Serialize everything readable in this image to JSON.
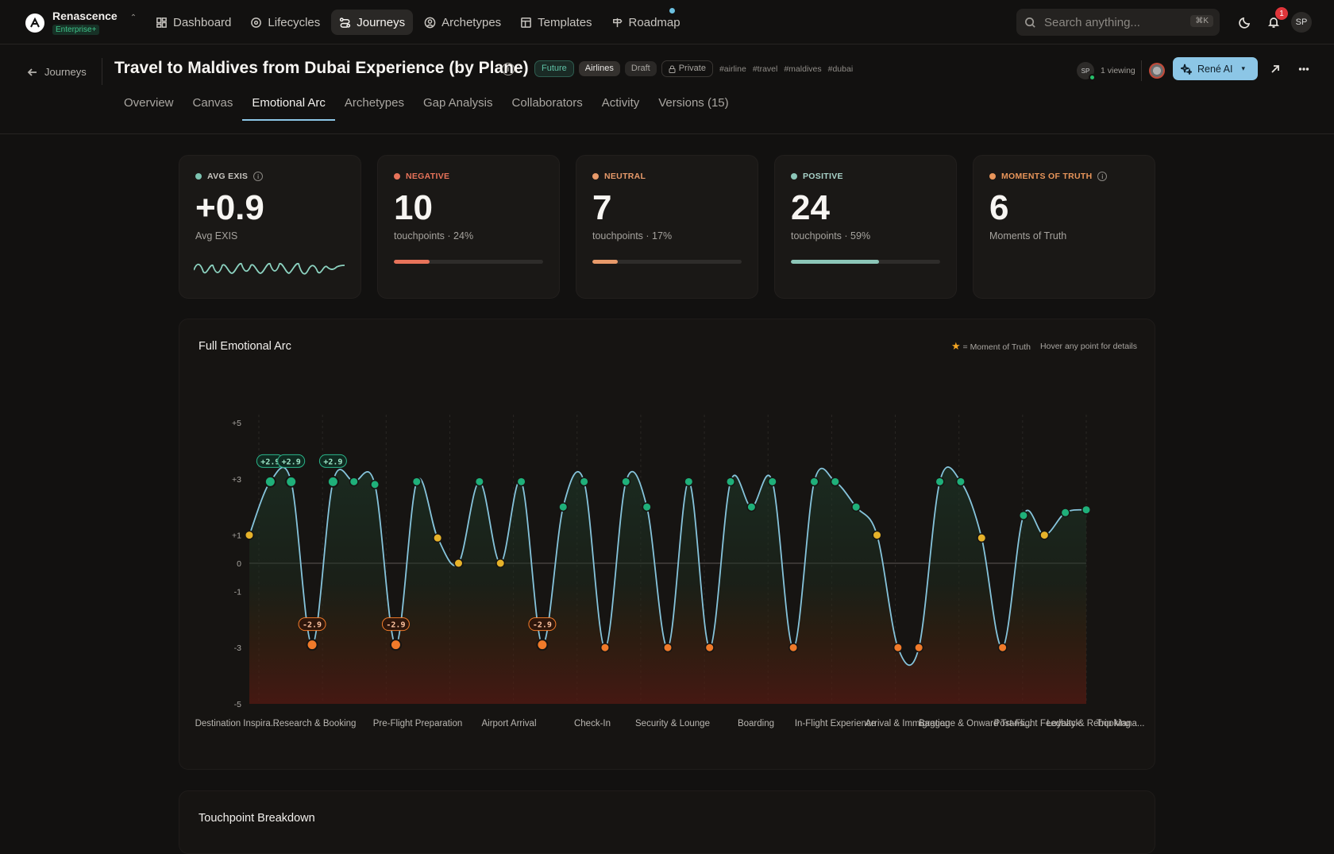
{
  "brand": {
    "name": "Renascence",
    "plan": "Enterprise+"
  },
  "nav": [
    {
      "label": "Dashboard",
      "icon": "dashboard-icon"
    },
    {
      "label": "Lifecycles",
      "icon": "lifecycle-icon"
    },
    {
      "label": "Journeys",
      "icon": "journeys-icon",
      "active": true
    },
    {
      "label": "Archetypes",
      "icon": "archetypes-icon"
    },
    {
      "label": "Templates",
      "icon": "templates-icon"
    },
    {
      "label": "Roadmap",
      "icon": "roadmap-icon"
    }
  ],
  "search": {
    "placeholder": "Search anything...",
    "shortcut": "⌘K"
  },
  "notifications": {
    "count": "1"
  },
  "user": {
    "initials": "SP"
  },
  "header": {
    "back_label": "Journeys",
    "title": "Travel to Maldives from Dubai Experience (by Plane)",
    "pills": {
      "future": "Future",
      "airlines": "Airlines",
      "draft": "Draft",
      "private": "Private"
    },
    "hashtags": [
      "#airline",
      "#travel",
      "#maldives",
      "#dubai"
    ],
    "viewing": "1 viewing",
    "viewer_initials": "SP",
    "ai_label": "René AI"
  },
  "tabs": [
    "Overview",
    "Canvas",
    "Emotional Arc",
    "Archetypes",
    "Gap Analysis",
    "Collaborators",
    "Activity",
    "Versions (15)"
  ],
  "active_tab": "Emotional Arc",
  "stats": {
    "avg": {
      "label": "AVG EXIS",
      "value": "+0.9",
      "sub": "Avg EXIS",
      "color": "#7cc3b0"
    },
    "negative": {
      "label": "NEGATIVE",
      "value": "10",
      "sub": "touchpoints · 24%",
      "pct": 24,
      "color": "#e8735a"
    },
    "neutral": {
      "label": "NEUTRAL",
      "value": "7",
      "sub": "touchpoints · 17%",
      "pct": 17,
      "color": "#e89a6a"
    },
    "positive": {
      "label": "POSITIVE",
      "value": "24",
      "sub": "touchpoints · 59%",
      "pct": 59,
      "color": "#8cc6b8"
    },
    "mot": {
      "label": "MOMENTS OF TRUTH",
      "value": "6",
      "sub": "Moments of Truth",
      "color": "#e8955a"
    }
  },
  "arc": {
    "title": "Full Emotional Arc",
    "legend_mot": "= Moment of Truth",
    "legend_hint": "Hover any point for details"
  },
  "chart_data": {
    "type": "line",
    "title": "Full Emotional Arc",
    "ylim": [
      -5,
      5
    ],
    "yticks": [
      "+5",
      "+3",
      "+1",
      "0",
      "-1",
      "-3",
      "-5"
    ],
    "ytick_values": [
      5,
      3,
      1,
      0,
      -1,
      -3,
      -5
    ],
    "categories": [
      "Destination Inspiration",
      "Research & Booking",
      "Pre-Flight Preparation",
      "Airport Arrival",
      "Check-In",
      "Security & Lounge",
      "Boarding",
      "In-Flight Experience",
      "Arrival & Immigration",
      "Baggage & Onward Transit",
      "Post-Flight Feedback",
      "Loyalty & Rebooking",
      "Trip Management"
    ],
    "category_labels": [
      "Destination Inspira...",
      "Research & Booking",
      "Pre-Flight Preparation",
      "Airport Arrival",
      "Check-In",
      "Security & Lounge",
      "Boarding",
      "In-Flight Experience",
      "Arrival & Immigration",
      "Baggage & Onward Trans...",
      "Post-Flight Feedback",
      "Loyalty & Rebooking",
      "Trip Mana..."
    ],
    "values": [
      1,
      2.9,
      2.9,
      -2.9,
      2.9,
      2.9,
      2.8,
      -2.9,
      2.9,
      0.9,
      0,
      2.9,
      0,
      2.9,
      -2.9,
      2,
      2.9,
      -3,
      2.9,
      2,
      -3,
      2.9,
      -3,
      2.9,
      2,
      2.9,
      -3,
      2.9,
      2.9,
      2,
      1,
      -3,
      -3,
      2.9,
      2.9,
      0.9,
      -3,
      1.7,
      1,
      1.8,
      1.9
    ],
    "moments_of_truth": [
      1,
      2,
      3,
      4,
      7,
      14
    ],
    "mot_labels": [
      "+2.9",
      "+2.9",
      "-2.9",
      "+2.9",
      "-2.9",
      "-2.9"
    ]
  },
  "breakdown": {
    "title": "Touchpoint Breakdown"
  }
}
